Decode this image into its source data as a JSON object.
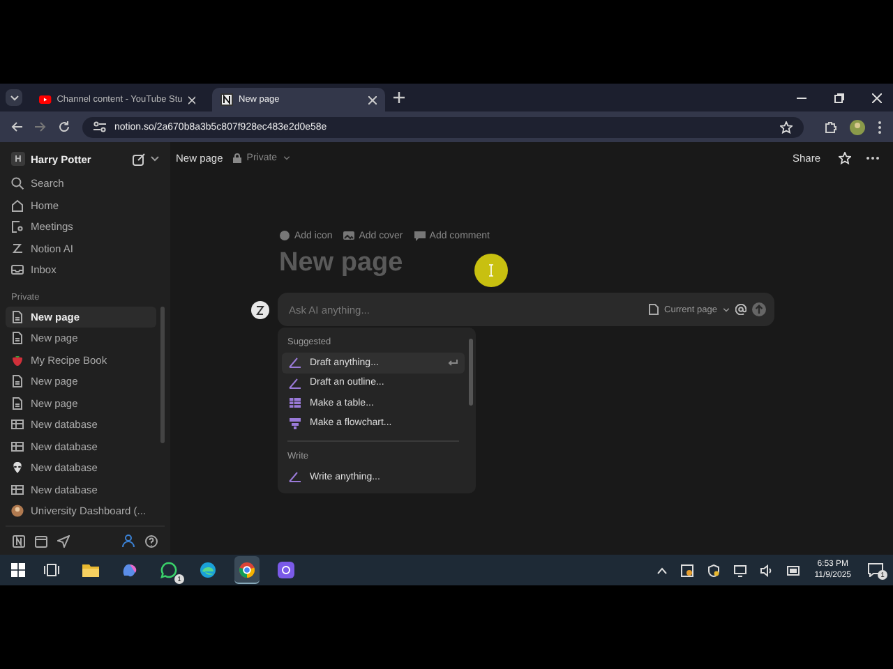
{
  "browser": {
    "tabs": [
      {
        "title": "Channel content - YouTube Stu",
        "kind": "youtube",
        "selected": false
      },
      {
        "title": "New page",
        "kind": "notion",
        "selected": true
      }
    ],
    "address": "notion.so/2a670b8a3b5c807f928ec483e2d0e58e"
  },
  "sidebar": {
    "workspace_initial": "H",
    "workspace": "Harry Potter",
    "nav": [
      {
        "label": "Search",
        "kind": "search"
      },
      {
        "label": "Home",
        "kind": "home"
      },
      {
        "label": "Meetings",
        "kind": "meetings"
      },
      {
        "label": "Notion AI",
        "kind": "ai"
      },
      {
        "label": "Inbox",
        "kind": "inbox"
      }
    ],
    "section": "Private",
    "pages": [
      {
        "label": "New page",
        "kind": "page",
        "selected": true
      },
      {
        "label": "New page",
        "kind": "page",
        "selected": false
      },
      {
        "label": "My Recipe Book",
        "kind": "strawberry",
        "selected": false
      },
      {
        "label": "New page",
        "kind": "page",
        "selected": false
      },
      {
        "label": "New page",
        "kind": "page",
        "selected": false
      },
      {
        "label": "New database",
        "kind": "database",
        "selected": false
      },
      {
        "label": "New database",
        "kind": "database",
        "selected": false
      },
      {
        "label": "New database",
        "kind": "alien",
        "selected": false
      },
      {
        "label": "New database",
        "kind": "database",
        "selected": false
      },
      {
        "label": "University Dashboard (...",
        "kind": "avatar",
        "selected": false
      }
    ]
  },
  "page": {
    "breadcrumb": "New page",
    "privacy": "Private",
    "share": "Share",
    "actions": [
      {
        "label": "Add icon",
        "kind": "icon"
      },
      {
        "label": "Add cover",
        "kind": "cover"
      },
      {
        "label": "Add comment",
        "kind": "comment"
      }
    ],
    "title_placeholder": "New page",
    "ai": {
      "placeholder": "Ask AI anything...",
      "scope": "Current page",
      "menu": [
        {
          "heading": "Suggested",
          "items": [
            {
              "label": "Draft anything...",
              "kind": "pen",
              "selected": true
            },
            {
              "label": "Draft an outline...",
              "kind": "pen",
              "selected": false
            },
            {
              "label": "Make a table...",
              "kind": "table",
              "selected": false
            },
            {
              "label": "Make a flowchart...",
              "kind": "flowchart",
              "selected": false
            }
          ]
        },
        {
          "heading": "Write",
          "items": [
            {
              "label": "Write anything...",
              "kind": "pen",
              "selected": false
            }
          ]
        }
      ]
    }
  },
  "taskbar": {
    "apps": [
      {
        "kind": "taskview",
        "selected": false
      },
      {
        "kind": "folder",
        "selected": false
      },
      {
        "kind": "copilot",
        "selected": false
      },
      {
        "kind": "chat",
        "selected": false,
        "badge": "1"
      },
      {
        "kind": "edge",
        "selected": false
      },
      {
        "kind": "chrome",
        "selected": true
      },
      {
        "kind": "purple",
        "selected": false
      }
    ],
    "time": "6:53 PM",
    "date": "11/9/2025",
    "notifications": "1"
  }
}
